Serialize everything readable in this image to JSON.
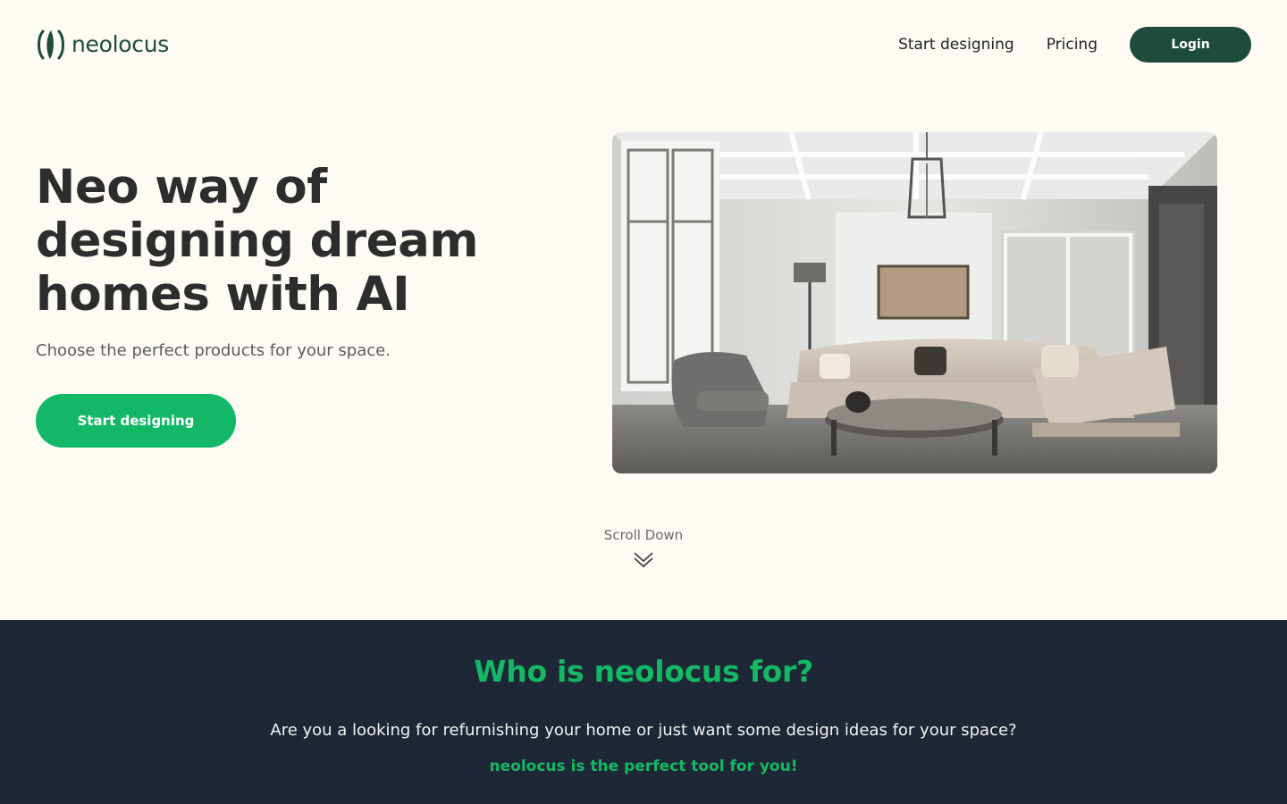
{
  "header": {
    "brand_name": "neolocus",
    "nav": [
      {
        "label": "Start designing"
      },
      {
        "label": "Pricing"
      }
    ],
    "login_label": "Login"
  },
  "hero": {
    "title": "Neo way of designing dream homes with AI",
    "subtitle": "Choose the perfect products for your space.",
    "cta_label": "Start designing",
    "image_subject": "living-room-interior-photo"
  },
  "scroll": {
    "label": "Scroll Down",
    "icon": "double-chevron-down-icon"
  },
  "audience": {
    "title": "Who is neolocus for?",
    "question": "Are you a looking for refurnishing your home or just want some design ideas for your space?",
    "tagline": "neolocus is the perfect tool for you!"
  },
  "colors": {
    "page_background": "#fdfbf4",
    "brand_dark_green": "#1e4b3c",
    "accent_green": "#12b865",
    "dark_section": "#1e2735",
    "heading_text": "#2d2d2d"
  }
}
